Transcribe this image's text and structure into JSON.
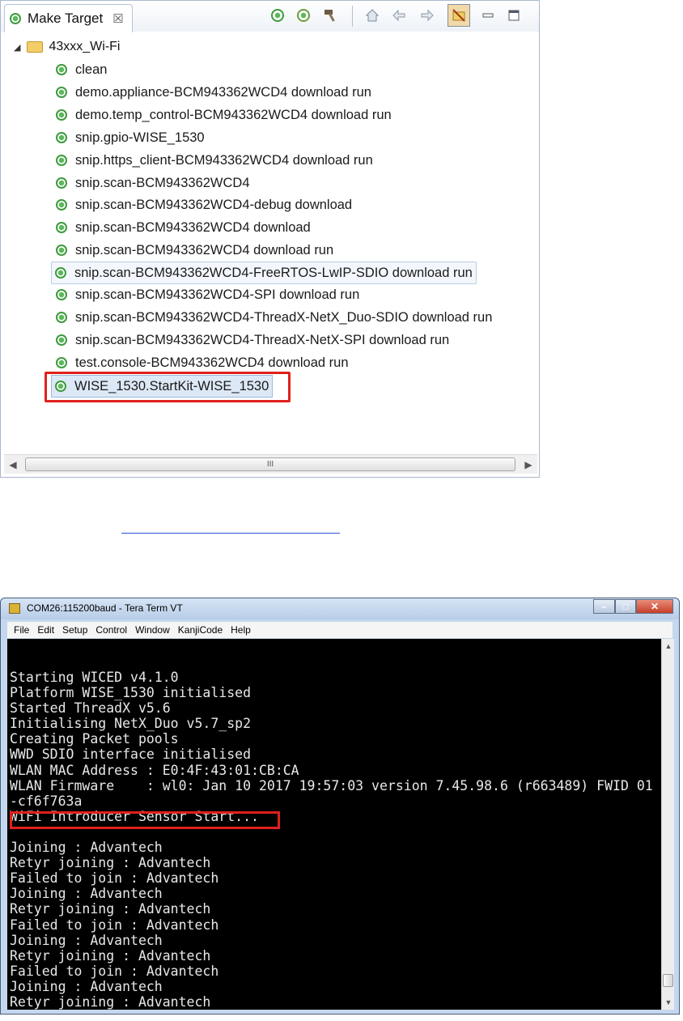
{
  "make_target": {
    "tab_label": "Make Target",
    "close_glyph": "☒",
    "toolbar_icons": [
      "new-target-icon",
      "edit-target-icon",
      "build-target-icon",
      "home-icon",
      "back-icon",
      "forward-icon",
      "hide-empty-folders-icon",
      "minimize-icon",
      "maximize-icon"
    ],
    "root_label": "43xxx_Wi-Fi",
    "items": [
      "clean",
      "demo.appliance-BCM943362WCD4 download run",
      "demo.temp_control-BCM943362WCD4 download run",
      "snip.gpio-WISE_1530",
      "snip.https_client-BCM943362WCD4 download run",
      "snip.scan-BCM943362WCD4",
      "snip.scan-BCM943362WCD4-debug download",
      "snip.scan-BCM943362WCD4 download",
      "snip.scan-BCM943362WCD4 download run",
      "snip.scan-BCM943362WCD4-FreeRTOS-LwIP-SDIO download run",
      "snip.scan-BCM943362WCD4-SPI download run",
      "snip.scan-BCM943362WCD4-ThreadX-NetX_Duo-SDIO download run",
      "snip.scan-BCM943362WCD4-ThreadX-NetX-SPI download run",
      "test.console-BCM943362WCD4 download run",
      "WISE_1530.StartKit-WISE_1530"
    ],
    "scrollbar_thumb_label": "III",
    "colors": {
      "highlight_border": "#e0201b",
      "target_icon": "#3d9a3d"
    }
  },
  "teraterm": {
    "title": "COM26:115200baud - Tera Term VT",
    "window_buttons": [
      "–",
      "□",
      "✕"
    ],
    "menu": [
      "File",
      "Edit",
      "Setup",
      "Control",
      "Window",
      "KanjiCode",
      "Help"
    ],
    "console_lines": [
      "Starting WICED v4.1.0",
      "Platform WISE_1530 initialised",
      "Started ThreadX v5.6",
      "Initialising NetX_Duo v5.7_sp2",
      "Creating Packet pools",
      "WWD SDIO interface initialised",
      "WLAN MAC Address : E0:4F:43:01:CB:CA",
      "WLAN Firmware    : wl0: Jan 10 2017 19:57:03 version 7.45.98.6 (r663489) FWID 01",
      "-cf6f763a",
      "WiFi Introducer Sensor Start...",
      "",
      "Joining : Advantech",
      "Retyr joining : Advantech",
      "Failed to join : Advantech",
      "Joining : Advantech",
      "Retyr joining : Advantech",
      "Failed to join : Advantech",
      "Joining : Advantech",
      "Retyr joining : Advantech",
      "Failed to join : Advantech",
      "Joining : Advantech",
      "Retyr joining : Advantech"
    ],
    "colors": {
      "console_bg": "#000000",
      "console_fg": "#e8e8e8",
      "highlight_border": "#e0201b"
    }
  }
}
